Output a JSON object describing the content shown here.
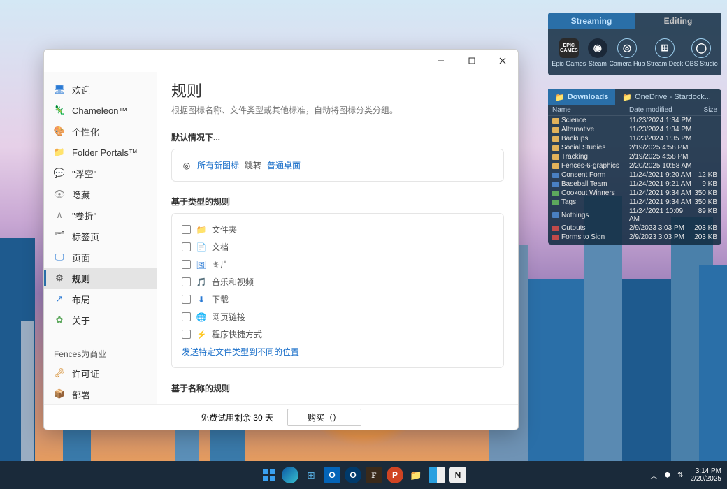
{
  "widget": {
    "tabs": [
      "Streaming",
      "Editing"
    ],
    "apps": [
      {
        "label": "Epic Games",
        "icon": "epic"
      },
      {
        "label": "Steam",
        "icon": "steam"
      },
      {
        "label": "Camera Hub",
        "icon": "cam"
      },
      {
        "label": "Stream Deck",
        "icon": "deck"
      },
      {
        "label": "OBS Studio",
        "icon": "obs"
      }
    ]
  },
  "fence": {
    "tabs": [
      "Downloads",
      "OneDrive - Stardock..."
    ],
    "columns": {
      "name": "Name",
      "date": "Date modified",
      "size": "Size"
    },
    "rows": [
      {
        "icon": "fld",
        "name": "Science",
        "date": "11/23/2024 1:34 PM",
        "size": ""
      },
      {
        "icon": "fld",
        "name": "Alternative",
        "date": "11/23/2024 1:34 PM",
        "size": ""
      },
      {
        "icon": "fld",
        "name": "Backups",
        "date": "11/23/2024 1:35 PM",
        "size": ""
      },
      {
        "icon": "fld",
        "name": "Social Studies",
        "date": "2/19/2025 4:58 PM",
        "size": ""
      },
      {
        "icon": "fld",
        "name": "Tracking",
        "date": "2/19/2025 4:58 PM",
        "size": ""
      },
      {
        "icon": "fld",
        "name": "Fences-6-graphics",
        "date": "2/20/2025 10:58 AM",
        "size": ""
      },
      {
        "icon": "doc",
        "name": "Consent Form",
        "date": "11/24/2021 9:20 AM",
        "size": "12 KB"
      },
      {
        "icon": "doc",
        "name": "Baseball Team",
        "date": "11/24/2021 9:21 AM",
        "size": "9 KB"
      },
      {
        "icon": "img",
        "name": "Cookout Winners",
        "date": "11/24/2021 9:34 AM",
        "size": "350 KB"
      },
      {
        "icon": "img",
        "name": "Tags",
        "date": "11/24/2021 9:34 AM",
        "size": "350 KB"
      },
      {
        "icon": "doc",
        "name": "Nothings",
        "date": "11/24/2021 10:09 AM",
        "size": "89 KB"
      },
      {
        "icon": "pdf",
        "name": "Cutouts",
        "date": "2/9/2023 3:03 PM",
        "size": "203 KB"
      },
      {
        "icon": "pdf",
        "name": "Forms to Sign",
        "date": "2/9/2023 3:03 PM",
        "size": "203 KB"
      }
    ]
  },
  "window": {
    "sidebar": {
      "items": [
        {
          "icon": "🖥",
          "label": "欢迎",
          "color": "#2a7ad4"
        },
        {
          "icon": "🦎",
          "label": "Chameleon™",
          "color": "#d45a2a"
        },
        {
          "icon": "🎨",
          "label": "个性化",
          "color": "#2a7ad4"
        },
        {
          "icon": "📁",
          "label": "Folder Portals™",
          "color": "#e2a23c"
        },
        {
          "icon": "💬",
          "label": "\"浮空\"",
          "color": "#2a7ad4"
        },
        {
          "icon": "👁",
          "label": "隐藏",
          "color": "#888"
        },
        {
          "icon": "∧",
          "label": "\"卷折\"",
          "color": "#888"
        },
        {
          "icon": "🗂",
          "label": "标签页",
          "color": "#666"
        },
        {
          "icon": "🖵",
          "label": "页面",
          "color": "#2a7ad4"
        },
        {
          "icon": "⚙",
          "label": "规则",
          "color": "#666",
          "active": true
        },
        {
          "icon": "↗",
          "label": "布局",
          "color": "#2a7ad4"
        },
        {
          "icon": "✿",
          "label": "关于",
          "color": "#5da85d"
        }
      ],
      "section_label": "Fences为商业",
      "section_items": [
        {
          "icon": "🗝",
          "label": "许可证",
          "color": "#d48a2a"
        },
        {
          "icon": "📦",
          "label": "部署",
          "color": "#2a7ad4"
        }
      ]
    },
    "content": {
      "title": "规则",
      "subtitle": "根据图标名称、文件类型或其他标准，自动将图标分类分组。",
      "default_heading": "默认情况下...",
      "default_card": {
        "prefix": "所有新图标",
        "verb": "跳转",
        "link": "普通桌面"
      },
      "type_heading": "基于类型的规则",
      "type_rules": [
        {
          "icon": "📁",
          "label": "文件夹",
          "color": "#e2a23c"
        },
        {
          "icon": "📄",
          "label": "文档",
          "color": "#888"
        },
        {
          "icon": "🖼",
          "label": "图片",
          "color": "#2a7ad4"
        },
        {
          "icon": "🎵",
          "label": "音乐和视频",
          "color": "#2a7ad4"
        },
        {
          "icon": "⬇",
          "label": "下载",
          "color": "#2a7ad4"
        },
        {
          "icon": "🌐",
          "label": "网页链接",
          "color": "#888"
        },
        {
          "icon": "⚡",
          "label": "程序快捷方式",
          "color": "#888"
        }
      ],
      "type_link": "发送特定文件类型到不同的位置",
      "name_heading": "基于名称的规则"
    },
    "footer": {
      "trial": "免费试用剩余 30 天",
      "buy": "购买（）"
    }
  },
  "taskbar": {
    "time": "3:14 PM",
    "date": "2/20/2025",
    "icons": [
      "start",
      "edge",
      "files",
      "outlook",
      "o",
      "f",
      "p",
      "folder",
      "finder",
      "n"
    ]
  }
}
